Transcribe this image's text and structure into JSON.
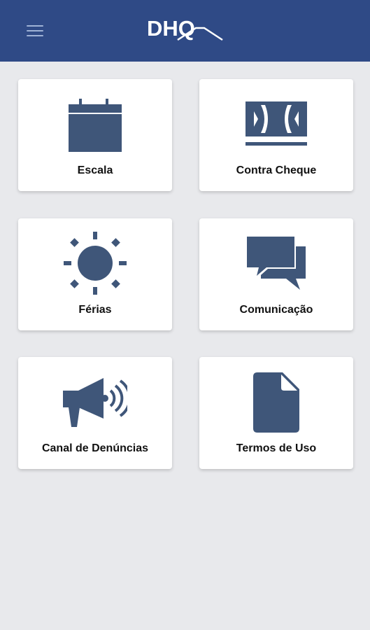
{
  "header": {
    "logo_text": "DHQ",
    "menu_icon": "hamburger-icon"
  },
  "colors": {
    "appbar": "#2f4a86",
    "icon": "#3f5679",
    "background": "#e8e9ec"
  },
  "cards": [
    {
      "label": "Escala",
      "icon": "calendar-icon"
    },
    {
      "label": "Contra Cheque",
      "icon": "money-icon"
    },
    {
      "label": "Férias",
      "icon": "sun-icon"
    },
    {
      "label": "Comunicação",
      "icon": "chat-icon"
    },
    {
      "label": "Canal de Denúncias",
      "icon": "megaphone-icon"
    },
    {
      "label": "Termos de Uso",
      "icon": "document-icon"
    }
  ]
}
